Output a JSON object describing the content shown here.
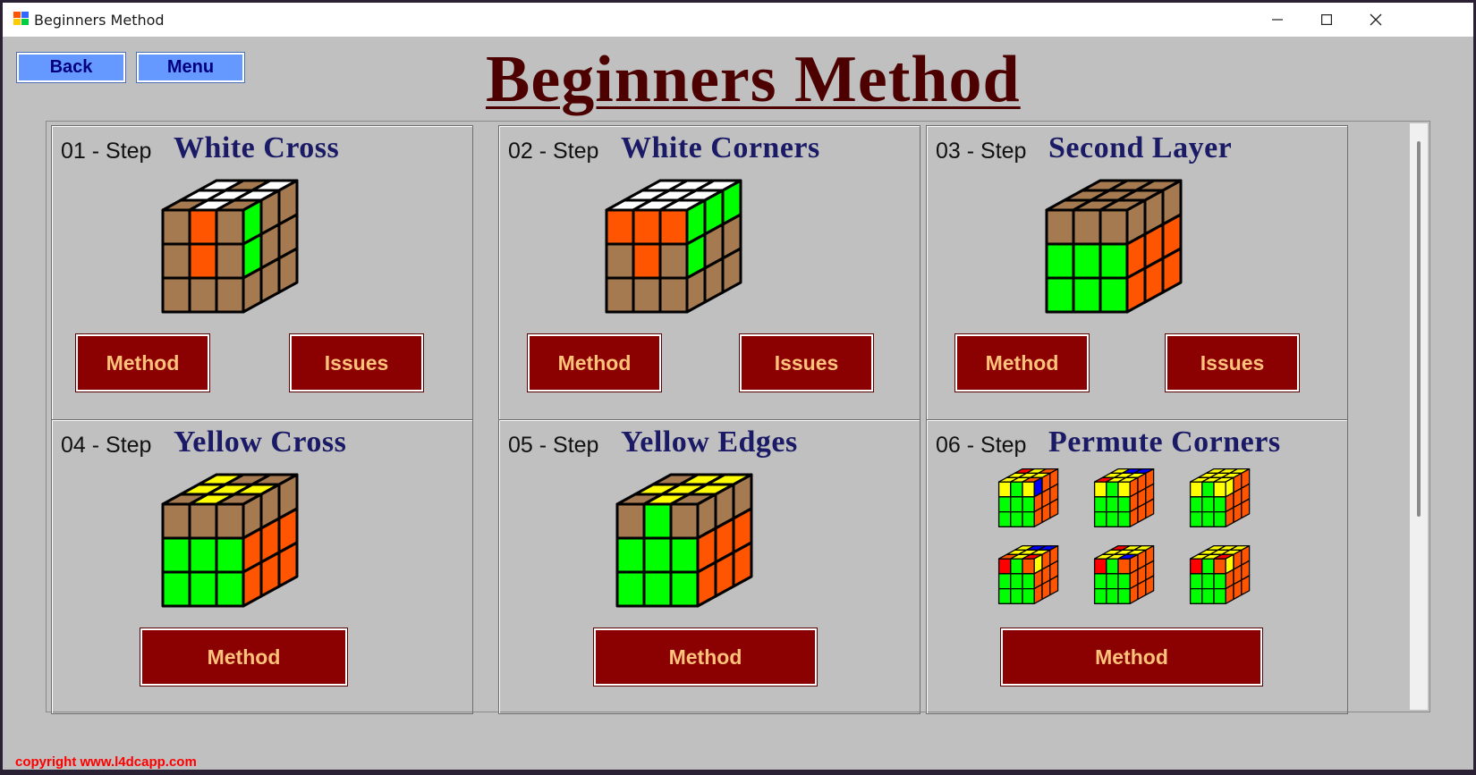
{
  "window": {
    "title": "Beginners Method"
  },
  "nav": {
    "back_label": "Back",
    "menu_label": "Menu"
  },
  "heading": "Beginners Method",
  "steps": [
    {
      "step": "01 - Step",
      "title": "White Cross",
      "method_label": "Method",
      "issues_label": "Issues"
    },
    {
      "step": "02 - Step",
      "title": "White Corners",
      "method_label": "Method",
      "issues_label": "Issues"
    },
    {
      "step": "03 - Step",
      "title": "Second Layer",
      "method_label": "Method",
      "issues_label": "Issues"
    },
    {
      "step": "04 - Step",
      "title": "Yellow Cross",
      "method_label": "Method"
    },
    {
      "step": "05 - Step",
      "title": "Yellow Edges",
      "method_label": "Method"
    },
    {
      "step": "06 - Step",
      "title": "Permute Corners",
      "method_label": "Method"
    }
  ],
  "copyright": "copyright www.l4dcapp.com",
  "colors": {
    "background": "#c0c0c0",
    "heading": "#4d0000",
    "step_title": "#1a1a66",
    "button_red": "#8b0000",
    "button_text": "#ffc27a",
    "nav_button": "#6699ff",
    "copyright": "#ff0000"
  },
  "cube_colors": {
    "W": "#ffffff",
    "O": "#ff5500",
    "G": "#00ff00",
    "N": "#a57a50",
    "Y": "#ffff00",
    "R": "#ff0000",
    "B": "#0000ff"
  },
  "cubes": [
    {
      "top": [
        "W",
        "N",
        "W",
        "W",
        "W",
        "W",
        "N",
        "W",
        "N"
      ],
      "front": [
        "N",
        "O",
        "N",
        "N",
        "O",
        "N",
        "N",
        "N",
        "N"
      ],
      "right": [
        "G",
        "N",
        "N",
        "G",
        "N",
        "N",
        "N",
        "N",
        "N"
      ]
    },
    {
      "top": [
        "W",
        "W",
        "W",
        "W",
        "W",
        "W",
        "W",
        "W",
        "W"
      ],
      "front": [
        "O",
        "O",
        "O",
        "N",
        "O",
        "N",
        "N",
        "N",
        "N"
      ],
      "right": [
        "G",
        "G",
        "G",
        "G",
        "N",
        "N",
        "N",
        "N",
        "N"
      ]
    },
    {
      "top": [
        "N",
        "N",
        "N",
        "N",
        "N",
        "N",
        "N",
        "N",
        "N"
      ],
      "front": [
        "N",
        "N",
        "N",
        "G",
        "G",
        "G",
        "G",
        "G",
        "G"
      ],
      "right": [
        "N",
        "N",
        "N",
        "O",
        "O",
        "O",
        "O",
        "O",
        "O"
      ]
    },
    {
      "top": [
        "Y",
        "N",
        "N",
        "Y",
        "Y",
        "Y",
        "N",
        "Y",
        "N"
      ],
      "front": [
        "N",
        "N",
        "N",
        "G",
        "G",
        "G",
        "G",
        "G",
        "G"
      ],
      "right": [
        "N",
        "N",
        "N",
        "O",
        "O",
        "O",
        "O",
        "O",
        "O"
      ]
    },
    {
      "top": [
        "N",
        "Y",
        "Y",
        "Y",
        "Y",
        "Y",
        "N",
        "Y",
        "N"
      ],
      "front": [
        "N",
        "G",
        "N",
        "G",
        "G",
        "G",
        "G",
        "G",
        "G"
      ],
      "right": [
        "N",
        "N",
        "N",
        "O",
        "O",
        "O",
        "O",
        "O",
        "O"
      ]
    }
  ],
  "mini_cubes": [
    {
      "top": [
        "R",
        "Y",
        "O",
        "Y",
        "Y",
        "Y",
        "Y",
        "Y",
        "O"
      ],
      "front": [
        "Y",
        "G",
        "Y",
        "G",
        "G",
        "G",
        "G",
        "G",
        "G"
      ],
      "right": [
        "B",
        "O",
        "O",
        "O",
        "O",
        "O",
        "O",
        "O",
        "O"
      ]
    },
    {
      "top": [
        "Y",
        "B",
        "B",
        "Y",
        "Y",
        "Y",
        "R",
        "Y",
        "Y"
      ],
      "front": [
        "Y",
        "G",
        "Y",
        "G",
        "G",
        "G",
        "G",
        "G",
        "G"
      ],
      "right": [
        "O",
        "O",
        "O",
        "O",
        "O",
        "O",
        "O",
        "O",
        "O"
      ]
    },
    {
      "top": [
        "Y",
        "Y",
        "Y",
        "Y",
        "Y",
        "Y",
        "Y",
        "Y",
        "Y"
      ],
      "front": [
        "Y",
        "G",
        "Y",
        "G",
        "G",
        "G",
        "G",
        "G",
        "G"
      ],
      "right": [
        "Y",
        "O",
        "O",
        "O",
        "O",
        "O",
        "O",
        "O",
        "O"
      ]
    },
    {
      "top": [
        "Y",
        "B",
        "B",
        "Y",
        "Y",
        "Y",
        "O",
        "Y",
        "R"
      ],
      "front": [
        "R",
        "G",
        "O",
        "G",
        "G",
        "G",
        "G",
        "G",
        "G"
      ],
      "right": [
        "Y",
        "O",
        "O",
        "O",
        "O",
        "O",
        "O",
        "O",
        "O"
      ]
    },
    {
      "top": [
        "R",
        "Y",
        "Y",
        "Y",
        "Y",
        "Y",
        "Y",
        "Y",
        "B"
      ],
      "front": [
        "R",
        "G",
        "O",
        "G",
        "G",
        "G",
        "G",
        "G",
        "G"
      ],
      "right": [
        "O",
        "O",
        "O",
        "O",
        "O",
        "O",
        "O",
        "O",
        "O"
      ]
    },
    {
      "top": [
        "Y",
        "Y",
        "Y",
        "Y",
        "Y",
        "Y",
        "Y",
        "Y",
        "R"
      ],
      "front": [
        "R",
        "G",
        "O",
        "G",
        "G",
        "G",
        "G",
        "G",
        "G"
      ],
      "right": [
        "Y",
        "O",
        "O",
        "O",
        "O",
        "O",
        "O",
        "O",
        "O"
      ]
    }
  ]
}
